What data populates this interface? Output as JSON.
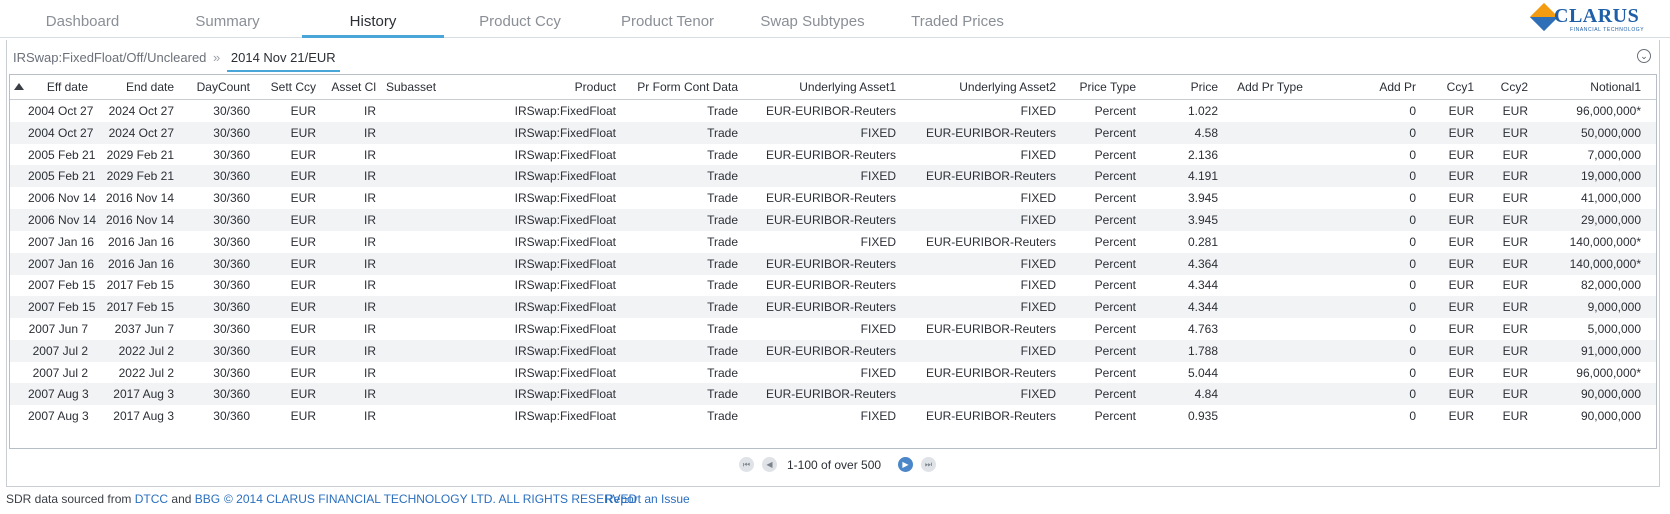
{
  "nav": {
    "tabs": [
      "Dashboard",
      "Summary",
      "History",
      "Product Ccy",
      "Product Tenor",
      "Swap Subtypes",
      "Traded Prices"
    ],
    "active": "History"
  },
  "logo": {
    "text": "CLARUS",
    "sub": "FINANCIAL TECHNOLOGY"
  },
  "breadcrumb": {
    "path": "IRSwap:FixedFloat/Off/Uncleared",
    "separator": "»",
    "current": "2014 Nov 21/EUR"
  },
  "table": {
    "columns": [
      "Eff date",
      "End date",
      "DayCount",
      "Sett Ccy",
      "Asset Cl",
      "Subasset",
      "Product",
      "Pr Form Cont Data",
      "Underlying Asset1",
      "Underlying Asset2",
      "Price Type",
      "Price",
      "Add Pr Type",
      "Add Pr",
      "Ccy1",
      "Ccy2",
      "Notional1"
    ],
    "rows": [
      [
        "2004 Oct 27",
        "2024 Oct 27",
        "30/360",
        "EUR",
        "IR",
        "",
        "IRSwap:FixedFloat",
        "Trade",
        "EUR-EURIBOR-Reuters",
        "FIXED",
        "Percent",
        "1.022",
        "",
        "0",
        "EUR",
        "EUR",
        "96,000,000*"
      ],
      [
        "2004 Oct 27",
        "2024 Oct 27",
        "30/360",
        "EUR",
        "IR",
        "",
        "IRSwap:FixedFloat",
        "Trade",
        "FIXED",
        "EUR-EURIBOR-Reuters",
        "Percent",
        "4.58",
        "",
        "0",
        "EUR",
        "EUR",
        "50,000,000"
      ],
      [
        "2005 Feb 21",
        "2029 Feb 21",
        "30/360",
        "EUR",
        "IR",
        "",
        "IRSwap:FixedFloat",
        "Trade",
        "EUR-EURIBOR-Reuters",
        "FIXED",
        "Percent",
        "2.136",
        "",
        "0",
        "EUR",
        "EUR",
        "7,000,000"
      ],
      [
        "2005 Feb 21",
        "2029 Feb 21",
        "30/360",
        "EUR",
        "IR",
        "",
        "IRSwap:FixedFloat",
        "Trade",
        "FIXED",
        "EUR-EURIBOR-Reuters",
        "Percent",
        "4.191",
        "",
        "0",
        "EUR",
        "EUR",
        "19,000,000"
      ],
      [
        "2006 Nov 14",
        "2016 Nov 14",
        "30/360",
        "EUR",
        "IR",
        "",
        "IRSwap:FixedFloat",
        "Trade",
        "EUR-EURIBOR-Reuters",
        "FIXED",
        "Percent",
        "3.945",
        "",
        "0",
        "EUR",
        "EUR",
        "41,000,000"
      ],
      [
        "2006 Nov 14",
        "2016 Nov 14",
        "30/360",
        "EUR",
        "IR",
        "",
        "IRSwap:FixedFloat",
        "Trade",
        "EUR-EURIBOR-Reuters",
        "FIXED",
        "Percent",
        "3.945",
        "",
        "0",
        "EUR",
        "EUR",
        "29,000,000"
      ],
      [
        "2007 Jan 16",
        "2016 Jan 16",
        "30/360",
        "EUR",
        "IR",
        "",
        "IRSwap:FixedFloat",
        "Trade",
        "FIXED",
        "EUR-EURIBOR-Reuters",
        "Percent",
        "0.281",
        "",
        "0",
        "EUR",
        "EUR",
        "140,000,000*"
      ],
      [
        "2007 Jan 16",
        "2016 Jan 16",
        "30/360",
        "EUR",
        "IR",
        "",
        "IRSwap:FixedFloat",
        "Trade",
        "EUR-EURIBOR-Reuters",
        "FIXED",
        "Percent",
        "4.364",
        "",
        "0",
        "EUR",
        "EUR",
        "140,000,000*"
      ],
      [
        "2007 Feb 15",
        "2017 Feb 15",
        "30/360",
        "EUR",
        "IR",
        "",
        "IRSwap:FixedFloat",
        "Trade",
        "EUR-EURIBOR-Reuters",
        "FIXED",
        "Percent",
        "4.344",
        "",
        "0",
        "EUR",
        "EUR",
        "82,000,000"
      ],
      [
        "2007 Feb 15",
        "2017 Feb 15",
        "30/360",
        "EUR",
        "IR",
        "",
        "IRSwap:FixedFloat",
        "Trade",
        "EUR-EURIBOR-Reuters",
        "FIXED",
        "Percent",
        "4.344",
        "",
        "0",
        "EUR",
        "EUR",
        "9,000,000"
      ],
      [
        "2007 Jun 7",
        "2037 Jun 7",
        "30/360",
        "EUR",
        "IR",
        "",
        "IRSwap:FixedFloat",
        "Trade",
        "FIXED",
        "EUR-EURIBOR-Reuters",
        "Percent",
        "4.763",
        "",
        "0",
        "EUR",
        "EUR",
        "5,000,000"
      ],
      [
        "2007 Jul 2",
        "2022 Jul 2",
        "30/360",
        "EUR",
        "IR",
        "",
        "IRSwap:FixedFloat",
        "Trade",
        "EUR-EURIBOR-Reuters",
        "FIXED",
        "Percent",
        "1.788",
        "",
        "0",
        "EUR",
        "EUR",
        "91,000,000"
      ],
      [
        "2007 Jul 2",
        "2022 Jul 2",
        "30/360",
        "EUR",
        "IR",
        "",
        "IRSwap:FixedFloat",
        "Trade",
        "FIXED",
        "EUR-EURIBOR-Reuters",
        "Percent",
        "5.044",
        "",
        "0",
        "EUR",
        "EUR",
        "96,000,000*"
      ],
      [
        "2007 Aug 3",
        "2017 Aug 3",
        "30/360",
        "EUR",
        "IR",
        "",
        "IRSwap:FixedFloat",
        "Trade",
        "EUR-EURIBOR-Reuters",
        "FIXED",
        "Percent",
        "4.84",
        "",
        "0",
        "EUR",
        "EUR",
        "90,000,000"
      ],
      [
        "2007 Aug 3",
        "2017 Aug 3",
        "30/360",
        "EUR",
        "IR",
        "",
        "IRSwap:FixedFloat",
        "Trade",
        "FIXED",
        "EUR-EURIBOR-Reuters",
        "Percent",
        "0.935",
        "",
        "0",
        "EUR",
        "EUR",
        "90,000,000"
      ]
    ]
  },
  "pager": {
    "text": "1-100 of over 500"
  },
  "footer": {
    "prefix": "SDR data sourced from",
    "dtcc": "DTCC",
    "and": "and",
    "bbg": "BBG",
    "copyright": "© 2014 CLARUS FINANCIAL TECHNOLOGY LTD. ALL RIGHTS RESERVED",
    "report": "Report an Issue"
  },
  "colors": {
    "accent": "#4aa6d8",
    "link": "#2a6fbf",
    "row_alt": "#f2f3f5"
  }
}
